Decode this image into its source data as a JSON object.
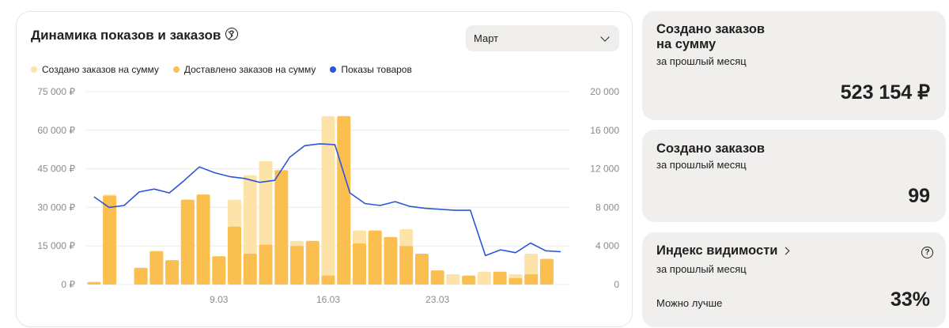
{
  "chart_card": {
    "title": "Динамика показов и заказов",
    "help_glyph": "?",
    "month_select": {
      "value": "Март"
    },
    "legend": [
      {
        "label": "Создано заказов на сумму",
        "color": "#fde3a8"
      },
      {
        "label": "Доставлено заказов на сумму",
        "color": "#fbbf4f"
      },
      {
        "label": "Показы товаров",
        "color": "#2b56d9"
      }
    ]
  },
  "chart_data": {
    "type": "bar",
    "days": [
      1,
      2,
      3,
      4,
      5,
      6,
      7,
      8,
      9,
      10,
      11,
      12,
      13,
      14,
      15,
      16,
      17,
      18,
      19,
      20,
      21,
      22,
      23,
      24,
      25,
      26,
      27,
      28,
      29,
      30,
      31
    ],
    "x_tick_labels": [
      {
        "label": "9.03",
        "day": 9
      },
      {
        "label": "16.03",
        "day": 16
      },
      {
        "label": "23.03",
        "day": 23
      }
    ],
    "left_axis": {
      "ticks": [
        "0 ₽",
        "15 000 ₽",
        "30 000 ₽",
        "45 000 ₽",
        "60 000 ₽",
        "75 000 ₽"
      ],
      "range": [
        0,
        75000
      ]
    },
    "right_axis": {
      "ticks": [
        "0",
        "4 000",
        "8 000",
        "12 000",
        "16 000",
        "20 000"
      ],
      "range": [
        0,
        20000
      ]
    },
    "grid": true,
    "series": [
      {
        "name": "Создано заказов на сумму",
        "axis": "left",
        "color": "#fde3a8",
        "values": [
          1000,
          35000,
          0,
          6500,
          13000,
          9500,
          33000,
          35000,
          11000,
          33000,
          42500,
          48000,
          15500,
          17000,
          3500,
          65500,
          18000,
          21000,
          18500,
          15000,
          21500,
          5500,
          0,
          4000,
          0,
          5000,
          4500,
          4000,
          12000,
          0,
          0
        ]
      },
      {
        "name": "Доставлено заказов на сумму",
        "axis": "left",
        "color": "#fbbf4f",
        "values": [
          1000,
          34500,
          0,
          6500,
          13000,
          9500,
          33000,
          35000,
          11000,
          22500,
          12000,
          15500,
          44500,
          15000,
          17000,
          3500,
          65500,
          16000,
          21000,
          18500,
          15000,
          12000,
          5500,
          0,
          3500,
          0,
          5000,
          2500,
          4000,
          10000,
          0
        ]
      },
      {
        "name": "Показы товаров",
        "axis": "right",
        "color": "#2b56d9",
        "values": [
          9100,
          8000,
          8200,
          9600,
          9900,
          9500,
          10800,
          12200,
          11600,
          11200,
          11000,
          10600,
          10800,
          13200,
          14400,
          14600,
          14500,
          9500,
          8400,
          8200,
          8600,
          8100,
          7900,
          7800,
          7700,
          7700,
          3000,
          3600,
          3300,
          4300,
          3500,
          3400
        ]
      }
    ]
  },
  "cards": [
    {
      "title_line1": "Создано заказов",
      "title_line2": "на сумму",
      "subtitle": "за прошлый месяц",
      "value": "523 154 ₽"
    },
    {
      "title": "Создано заказов",
      "subtitle": "за прошлый месяц",
      "value": "99"
    },
    {
      "title": "Индекс видимости",
      "subtitle": "за прошлый месяц",
      "status": "Можно лучше",
      "value": "33%",
      "help_glyph": "?"
    }
  ]
}
